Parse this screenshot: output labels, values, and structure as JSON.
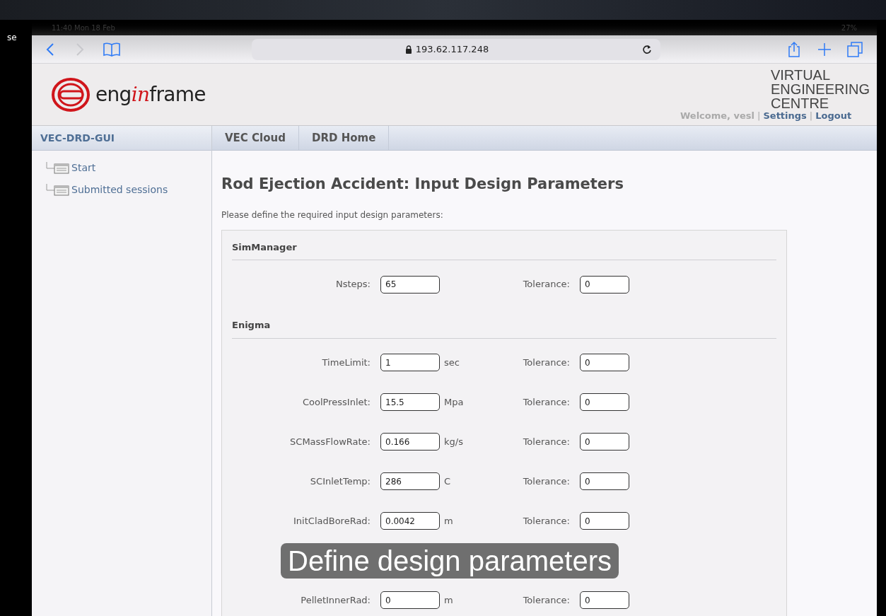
{
  "edge_text": "se",
  "status_bar": {
    "time": "11:40  Mon 18 Feb",
    "battery": "27%"
  },
  "browser": {
    "url": "193.62.117.248"
  },
  "header": {
    "logo_parts": [
      {
        "text": "eng",
        "accent": false
      },
      {
        "text": "in",
        "accent": true
      },
      {
        "text": "frame",
        "accent": false
      }
    ],
    "org_lines": [
      "VIRTUAL",
      "ENGINEERING",
      "CENTRE"
    ],
    "separator": "|",
    "user_links": [
      {
        "kind": "text",
        "label": "Welcome, vesl"
      },
      {
        "kind": "link",
        "label": "Settings"
      },
      {
        "kind": "link",
        "label": "Logout"
      }
    ]
  },
  "sidebar": {
    "title": "VEC-DRD-GUI",
    "items": [
      {
        "label": "Start"
      },
      {
        "label": "Submitted sessions"
      }
    ]
  },
  "tabs": [
    {
      "label": "VEC Cloud",
      "selected": false
    },
    {
      "label": "DRD Home",
      "selected": false
    }
  ],
  "page": {
    "title": "Rod Ejection Accident: Input Design Parameters",
    "intro": "Please define the required input design parameters:",
    "sections": [
      {
        "title": "SimManager",
        "rows": [
          {
            "label": "Nsteps:",
            "value": "65",
            "tolerance_label": "Tolerance:",
            "tolerance": "0"
          }
        ]
      },
      {
        "title": "Enigma",
        "rows": [
          {
            "label": "TimeLimit:",
            "value": "1",
            "unit": "sec",
            "tolerance_label": "Tolerance:",
            "tolerance": "0"
          },
          {
            "label": "CoolPressInlet:",
            "value": "15.5",
            "unit": "Mpa",
            "tolerance_label": "Tolerance:",
            "tolerance": "0"
          },
          {
            "label": "SCMassFlowRate:",
            "value": "0.166",
            "unit": "kg/s",
            "tolerance_label": "Tolerance:",
            "tolerance": "0"
          },
          {
            "label": "SCInletTemp:",
            "value": "286",
            "unit": "C",
            "tolerance_label": "Tolerance:",
            "tolerance": "0"
          },
          {
            "label": "InitCladBoreRad:",
            "value": "0.0042",
            "unit": "m",
            "tolerance_label": "Tolerance:",
            "tolerance": "0"
          },
          {
            "kind": "caption",
            "text": "Define design parameters"
          },
          {
            "label": "PelletInnerRad:",
            "value": "0",
            "unit": "m",
            "tolerance_label": "Tolerance:",
            "tolerance": "0"
          }
        ]
      }
    ]
  }
}
